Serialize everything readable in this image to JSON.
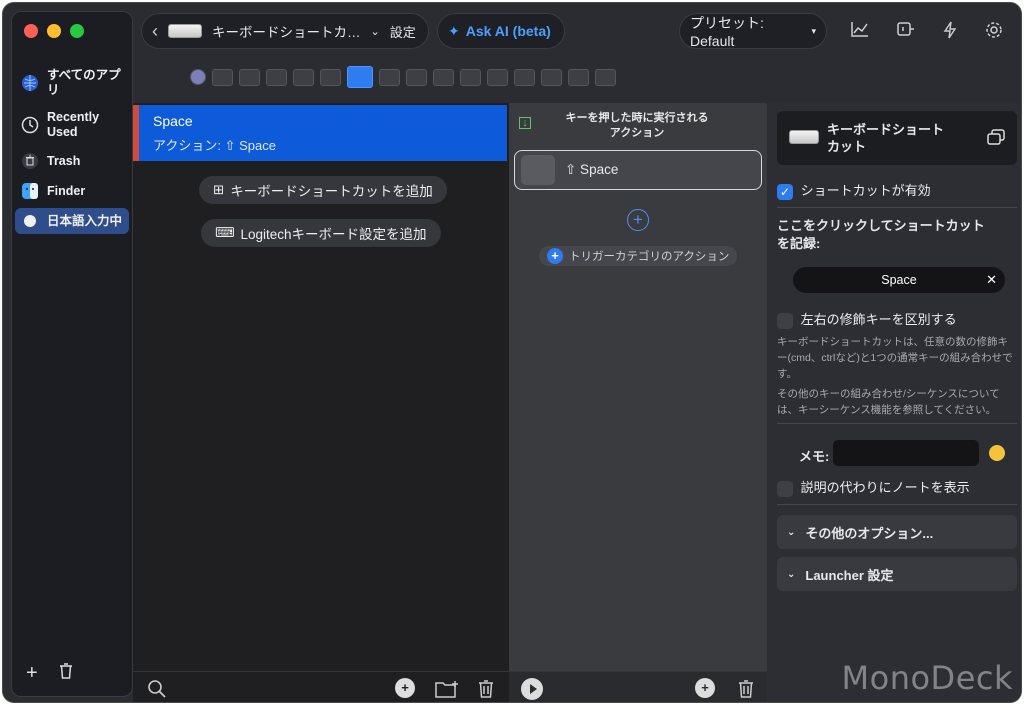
{
  "sidebar": {
    "items": [
      {
        "label": "すべてのアプリ",
        "icon": "globe-icon",
        "active": false
      },
      {
        "label": "Recently Used",
        "icon": "clock-icon",
        "active": false
      },
      {
        "label": "Trash",
        "icon": "trash-icon",
        "active": false
      },
      {
        "label": "Finder",
        "icon": "finder-icon",
        "active": false
      },
      {
        "label": "日本語入力中",
        "icon": "circle-icon",
        "active": true
      }
    ]
  },
  "topbar": {
    "device_name": "キーボードショートカ…",
    "settings_label": "設定",
    "ask_ai_label": "Ask AI (beta)",
    "preset_label": "プリセット: Default"
  },
  "list": {
    "selected_title": "Space",
    "selected_subtitle": "アクション: ⇧ Space",
    "add_shortcut_label": "キーボードショートカットを追加",
    "add_logitech_label": "Logitechキーボード設定を追加"
  },
  "middle": {
    "header": "キーを押した時に実行される\nアクション",
    "action_label": "⇧ Space",
    "trigger_category_label": "トリガーカテゴリのアクション"
  },
  "right": {
    "card_title": "キーボードショート\nカット",
    "enabled_label": "ショートカットが有効",
    "record_label": "ここをクリックしてショートカット\nを記録:",
    "shortcut_value": "Space",
    "distinguish_label": "左右の修飾キーを区別する",
    "note1": "キーボードショートカットは、任意の数の修飾キー(cmd、ctrlなど)と1つの通常キーの組み合わせです。",
    "note2": "その他のキーの組み合わせ/シーケンスについては、キーシーケンス機能を参照してください。",
    "memo_label": "メモ:",
    "show_note_label": "説明の代わりにノートを表示",
    "other_options_label": "その他のオプション...",
    "launcher_label": "Launcher 設定"
  },
  "watermark": "MonoDeck",
  "colors": {
    "accent": "#2d7cf0",
    "selected_row": "#0d5bd9"
  }
}
